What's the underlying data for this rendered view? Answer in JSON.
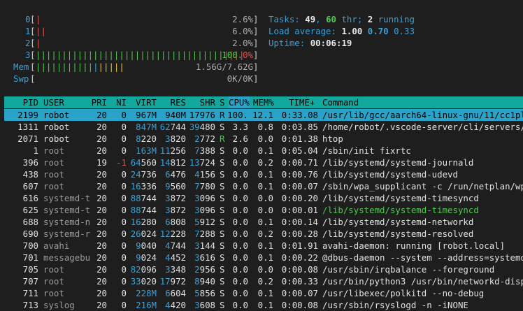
{
  "meters": {
    "cpus": [
      {
        "label": "0",
        "pct": "2.6%",
        "value": 2.6
      },
      {
        "label": "1",
        "pct": "6.0%",
        "value": 6.0
      },
      {
        "label": "2",
        "pct": "2.0%",
        "value": 2.0
      },
      {
        "label": "3",
        "pct": "100.0%",
        "value": 100.0
      }
    ],
    "mem": {
      "label": "Mem",
      "text": "1.56G/7.62G"
    },
    "swp": {
      "label": "Swp",
      "text": "0K/0K"
    }
  },
  "summary": {
    "tasks_label": "Tasks:",
    "tasks": "49",
    "thr": "60",
    "thr_label": "thr;",
    "running": "2",
    "running_label": "running",
    "load_label": "Load average:",
    "load1": "1.00",
    "load5": "0.70",
    "load15": "0.33",
    "uptime_label": "Uptime:",
    "uptime": "00:06:19"
  },
  "columns": [
    "PID",
    "USER",
    "PRI",
    "NI",
    "VIRT",
    "RES",
    "SHR",
    "S",
    "CPU%",
    "MEM%",
    "TIME+",
    "Command"
  ],
  "processes": [
    {
      "pid": "2199",
      "user": "robot",
      "pri": "20",
      "ni": "0",
      "virt": "967M",
      "res": "940M",
      "shr": "17976",
      "s": "R",
      "cpu": "100.",
      "mem": "12.1",
      "time": "0:33.08",
      "cmd": "/usr/lib/gcc/aarch64-linux-gnu/11/cc1plus",
      "selected": true
    },
    {
      "pid": "1311",
      "user": "robot",
      "pri": "20",
      "ni": "0",
      "virt": "847M",
      "res": "62744",
      "shr": "39480",
      "s": "S",
      "cpu": "3.3",
      "mem": "0.8",
      "time": "0:03.85",
      "cmd": "/home/robot/.vscode-server/cli/servers/St"
    },
    {
      "pid": "2071",
      "user": "robot",
      "pri": "20",
      "ni": "0",
      "virt": "8220",
      "res": "3820",
      "shr": "2772",
      "s": "R",
      "cpu": "2.6",
      "mem": "0.0",
      "time": "0:01.38",
      "cmd": "htop"
    },
    {
      "pid": "1",
      "user": "root",
      "pri": "20",
      "ni": "0",
      "virt": "163M",
      "res": "11256",
      "shr": "7388",
      "s": "S",
      "cpu": "0.0",
      "mem": "0.1",
      "time": "0:05.04",
      "cmd": "/sbin/init fixrtc"
    },
    {
      "pid": "396",
      "user": "root",
      "pri": "19",
      "ni": "-1",
      "virt": "64560",
      "res": "14812",
      "shr": "13724",
      "s": "S",
      "cpu": "0.0",
      "mem": "0.2",
      "time": "0:00.71",
      "cmd": "/lib/systemd/systemd-journald"
    },
    {
      "pid": "438",
      "user": "root",
      "pri": "20",
      "ni": "0",
      "virt": "24736",
      "res": "6476",
      "shr": "4156",
      "s": "S",
      "cpu": "0.0",
      "mem": "0.1",
      "time": "0:00.76",
      "cmd": "/lib/systemd/systemd-udevd"
    },
    {
      "pid": "607",
      "user": "root",
      "pri": "20",
      "ni": "0",
      "virt": "16336",
      "res": "9560",
      "shr": "7780",
      "s": "S",
      "cpu": "0.0",
      "mem": "0.1",
      "time": "0:00.07",
      "cmd": "/sbin/wpa_supplicant -c /run/netplan/wpa-"
    },
    {
      "pid": "616",
      "user": "systemd-t",
      "pri": "20",
      "ni": "0",
      "virt": "88744",
      "res": "3872",
      "shr": "3096",
      "s": "S",
      "cpu": "0.0",
      "mem": "0.0",
      "time": "0:00.20",
      "cmd": "/lib/systemd/systemd-timesyncd"
    },
    {
      "pid": "625",
      "user": "systemd-t",
      "pri": "20",
      "ni": "0",
      "virt": "88744",
      "res": "3872",
      "shr": "3096",
      "s": "S",
      "cpu": "0.0",
      "mem": "0.0",
      "time": "0:00.01",
      "cmd": "/lib/systemd/systemd-timesyncd",
      "thread": true
    },
    {
      "pid": "688",
      "user": "systemd-n",
      "pri": "20",
      "ni": "0",
      "virt": "16280",
      "res": "6808",
      "shr": "5912",
      "s": "S",
      "cpu": "0.0",
      "mem": "0.1",
      "time": "0:00.14",
      "cmd": "/lib/systemd/systemd-networkd"
    },
    {
      "pid": "690",
      "user": "systemd-r",
      "pri": "20",
      "ni": "0",
      "virt": "26024",
      "res": "12228",
      "shr": "7288",
      "s": "S",
      "cpu": "0.0",
      "mem": "0.2",
      "time": "0:00.28",
      "cmd": "/lib/systemd/systemd-resolved"
    },
    {
      "pid": "700",
      "user": "avahi",
      "pri": "20",
      "ni": "0",
      "virt": "9040",
      "res": "4744",
      "shr": "3144",
      "s": "S",
      "cpu": "0.0",
      "mem": "0.1",
      "time": "0:01.91",
      "cmd": "avahi-daemon: running [robot.local]"
    },
    {
      "pid": "701",
      "user": "messagebu",
      "pri": "20",
      "ni": "0",
      "virt": "9024",
      "res": "4452",
      "shr": "3616",
      "s": "S",
      "cpu": "0.0",
      "mem": "0.1",
      "time": "0:00.22",
      "cmd": "@dbus-daemon --system --address=systemd:"
    },
    {
      "pid": "705",
      "user": "root",
      "pri": "20",
      "ni": "0",
      "virt": "82096",
      "res": "3348",
      "shr": "2956",
      "s": "S",
      "cpu": "0.0",
      "mem": "0.0",
      "time": "0:00.08",
      "cmd": "/usr/sbin/irqbalance --foreground"
    },
    {
      "pid": "707",
      "user": "root",
      "pri": "20",
      "ni": "0",
      "virt": "33020",
      "res": "17972",
      "shr": "8940",
      "s": "S",
      "cpu": "0.0",
      "mem": "0.2",
      "time": "0:00.33",
      "cmd": "/usr/bin/python3 /usr/bin/networkd-dispat"
    },
    {
      "pid": "711",
      "user": "root",
      "pri": "20",
      "ni": "0",
      "virt": "228M",
      "res": "6604",
      "shr": "5856",
      "s": "S",
      "cpu": "0.0",
      "mem": "0.1",
      "time": "0:00.07",
      "cmd": "/usr/libexec/polkitd --no-debug"
    },
    {
      "pid": "713",
      "user": "syslog",
      "pri": "20",
      "ni": "0",
      "virt": "216M",
      "res": "4420",
      "shr": "3608",
      "s": "S",
      "cpu": "0.0",
      "mem": "0.1",
      "time": "0:00.08",
      "cmd": "/usr/sbin/rsyslogd -n -iNONE"
    }
  ],
  "colors": {
    "background": "#1e1e1e",
    "header_bg": "#13a89e",
    "selected_bg": "#2aa3c8",
    "cyan": "#3aa0d8",
    "green": "#4ec94e",
    "red": "#e05050",
    "yellow": "#e0c040"
  }
}
